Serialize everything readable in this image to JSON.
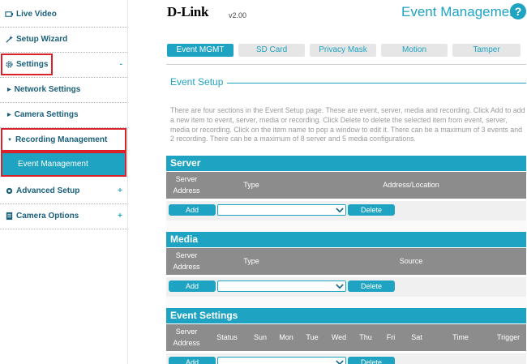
{
  "sidebar": {
    "items": [
      {
        "label": "Live Video",
        "icon": "video-icon"
      },
      {
        "label": "Setup Wizard",
        "icon": "wand-icon"
      },
      {
        "label": "Settings",
        "icon": "gear-icon",
        "toggle": "-"
      },
      {
        "label": "Network Settings",
        "icon": "arrow-right-icon"
      },
      {
        "label": "Camera Settings",
        "icon": "arrow-right-icon"
      },
      {
        "label": "Recording Management",
        "icon": "arrow-down-icon"
      },
      {
        "label": "Event Management"
      },
      {
        "label": "Advanced Setup",
        "icon": "cog-advanced-icon",
        "toggle": "+"
      },
      {
        "label": "Camera Options",
        "icon": "doc-icon",
        "toggle": "+"
      }
    ]
  },
  "header": {
    "brand": "D-Link",
    "version": "v2.00",
    "title": "Event Management",
    "help": "?"
  },
  "tabs": [
    "Event MGMT",
    "SD Card",
    "Privacy Mask",
    "Motion",
    "Tamper"
  ],
  "event_setup": {
    "title": "Event Setup",
    "description": "There are four sections in the Event Setup page. These are event, server, media and recording. Click Add to add a new item to event, server, media or recording. Click Delete to delete the selected item from event, server, media or recording. Click on the item name to pop a window to edit it. There can be a maximum of 3 events and 2 recording. There can be a maximum of 8 server and 5 media configurations."
  },
  "server": {
    "title": "Server",
    "columns": [
      "Server Address",
      "Type",
      "Address/Location"
    ],
    "add": "Add",
    "delete": "Delete"
  },
  "media": {
    "title": "Media",
    "columns": [
      "Server Address",
      "Type",
      "Source"
    ],
    "add": "Add",
    "delete": "Delete"
  },
  "event_settings": {
    "title": "Event Settings",
    "columns": [
      "Server Address",
      "Status",
      "Sun",
      "Mon",
      "Tue",
      "Wed",
      "Thu",
      "Fri",
      "Sat",
      "Time",
      "Trigger"
    ],
    "add": "Add",
    "delete": "Delete"
  },
  "colors": {
    "accent": "#1fa3c2",
    "highlight": "#d9222a",
    "column_header": "#8c8c8c"
  }
}
